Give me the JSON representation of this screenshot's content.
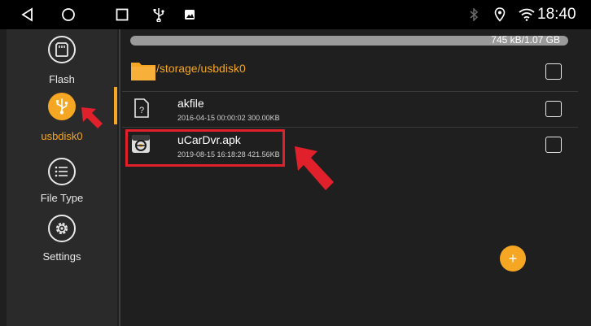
{
  "status_bar": {
    "time": "18:40",
    "icons": [
      "back-icon",
      "home-icon",
      "recents-icon",
      "usb-icon",
      "image-icon",
      "bluetooth-icon",
      "location-icon",
      "wifi-icon"
    ]
  },
  "sidebar": {
    "items": [
      {
        "label": "Flash",
        "icon": "flash-storage-icon"
      },
      {
        "label": "usbdisk0",
        "icon": "usb-icon",
        "active": true
      },
      {
        "label": "File Type",
        "icon": "list-icon"
      },
      {
        "label": "Settings",
        "icon": "gear-icon"
      }
    ]
  },
  "storage": {
    "usage_text": "745 kB/1.07 GB",
    "used_fraction": 0.0007
  },
  "path": {
    "label": "/storage/usbdisk0",
    "icon": "folder-icon"
  },
  "files": [
    {
      "name": "akfile",
      "meta": "2016-04-15 00:00:02   300.00KB",
      "icon": "unknown-file-icon"
    },
    {
      "name": "uCarDvr.apk",
      "meta": "2019-08-15 16:18:28   421.56KB",
      "icon": "apk-file-icon",
      "highlighted": true
    }
  ],
  "fab": {
    "label": "+"
  },
  "colors": {
    "accent": "#f5a623",
    "highlight": "#e0202a",
    "background": "#1f1f1f",
    "sidebar": "#2a2a2a"
  }
}
